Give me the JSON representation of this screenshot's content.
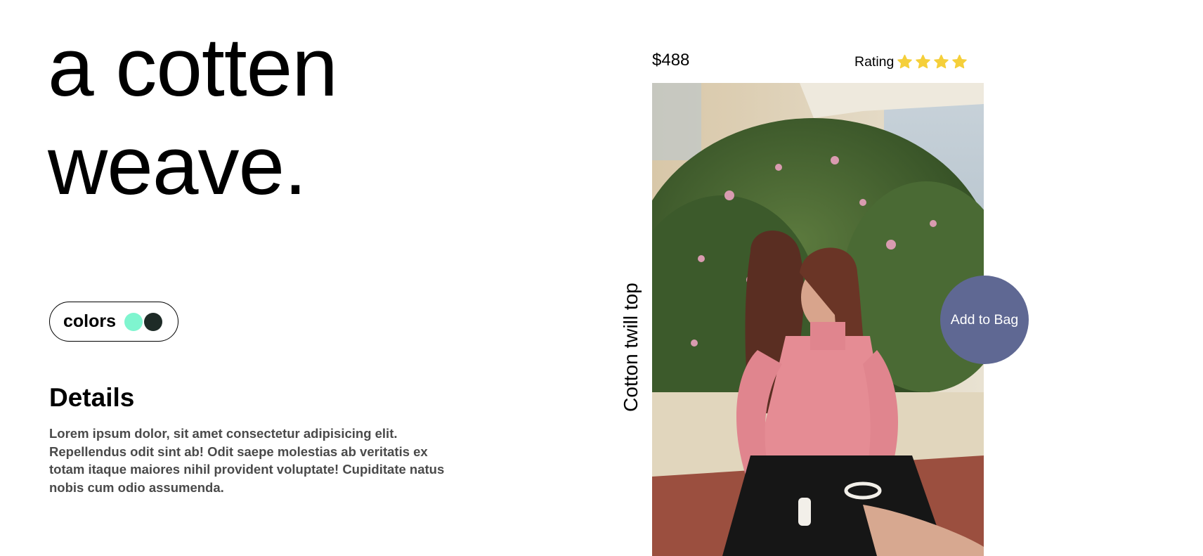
{
  "hero": {
    "line1": "a cotten",
    "line2": "weave."
  },
  "colors": {
    "label": "colors",
    "swatches": [
      "#7ff5cf",
      "#1e2b27"
    ]
  },
  "details": {
    "heading": "Details",
    "body": "Lorem ipsum dolor, sit amet consectetur adipisicing elit. Repellendus odit sint ab! Odit saepe molestias ab veritatis ex totam itaque maiores nihil provident voluptate! Cupiditate natus nobis cum odio assumenda."
  },
  "product": {
    "price": "$488",
    "rating_label": "Rating",
    "rating_stars": 4,
    "star_color": "#f5cf3a",
    "name": "Cotton twill top",
    "add_to_bag": "Add to Bag",
    "button_color": "#5f6893"
  }
}
